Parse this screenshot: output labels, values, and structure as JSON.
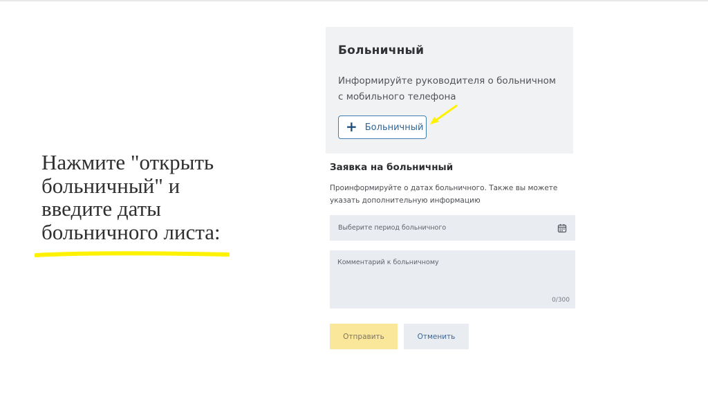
{
  "slide": {
    "instruction_text": "Нажмите \"открыть больничный\" и введите даты больничного листа:"
  },
  "sick_leave_card": {
    "title": "Больничный",
    "description": "Информируйте руководителя о больничном с мобильного телефона",
    "add_button_label": "Больничный"
  },
  "request_form": {
    "title": "Заявка на больничный",
    "description": "Проинформируйте о датах больничного. Также вы можете указать дополнительную информацию",
    "period_placeholder": "Выберите период больничного",
    "comment_placeholder": "Комментарий к больничному",
    "comment_counter": "0/300",
    "submit_label": "Отправить",
    "cancel_label": "Отменить"
  },
  "colors": {
    "highlight": "#fff200",
    "accent": "#3f7db2",
    "submit_bg": "#fbe79a",
    "field_bg": "#e9ecf1"
  },
  "icons": [
    "plus-icon",
    "calendar-icon",
    "annotation-arrow-icon"
  ]
}
